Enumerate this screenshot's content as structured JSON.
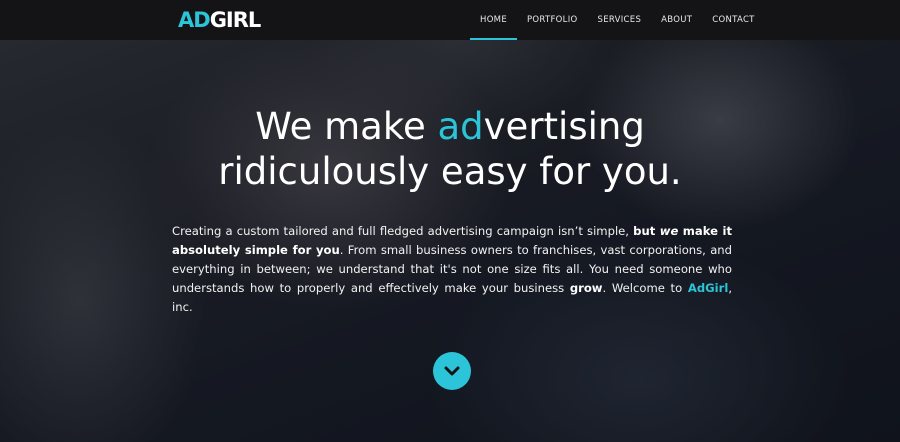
{
  "logo": {
    "part1": "AD",
    "part2": "GIRL"
  },
  "nav": {
    "items": [
      {
        "label": "HOME",
        "active": true
      },
      {
        "label": "PORTFOLIO",
        "active": false
      },
      {
        "label": "SERVICES",
        "active": false
      },
      {
        "label": "ABOUT",
        "active": false
      },
      {
        "label": "CONTACT",
        "active": false
      }
    ]
  },
  "hero": {
    "title_line1_pre": "We make ",
    "title_line1_accent": "ad",
    "title_line1_post": "vertising",
    "title_line2": "ridiculously easy for you.",
    "text_1": "Creating a custom tailored and full fledged advertising campaign isn’t simple, ",
    "text_bold_1": "but ",
    "text_bold_we": "we",
    "text_bold_2": " make it absolutely simple for you",
    "text_2": ". From small business owners to franchises, vast corporations, and everything in between; we understand that it's not one size fits all. You need someone who understands how to properly and effectively make your business ",
    "text_bold_grow": "grow",
    "text_3": ". Welcome to ",
    "text_brand": "AdGirl",
    "text_4": ", inc."
  },
  "scroll_button": {
    "icon": "chevron-down-icon"
  },
  "colors": {
    "accent": "#2cc4d8",
    "nav_bg": "#141416"
  }
}
